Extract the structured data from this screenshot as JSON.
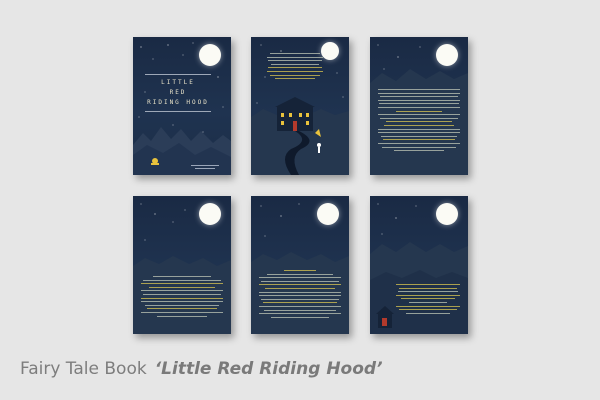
{
  "caption": {
    "prefix": "Fairy Tale Book",
    "title": "‘Little Red Riding Hood’"
  },
  "cover": {
    "line1": "LITTLE",
    "line2": "RED",
    "line3": "RIDING HOOD"
  },
  "colors": {
    "background": "#e6e6e6",
    "page": "#1b2d47",
    "moon": "#fbfbf5",
    "text_yellow": "#d9c650",
    "mountains": "#283a55"
  },
  "pages": [
    {
      "name": "cover",
      "icon": "moon-icon"
    },
    {
      "name": "house-scene",
      "icon": "house-icon"
    },
    {
      "name": "text-page-1",
      "icon": "moon-icon"
    },
    {
      "name": "text-page-2",
      "icon": "moon-icon"
    },
    {
      "name": "text-page-3",
      "icon": "moon-icon"
    },
    {
      "name": "final-page",
      "icon": "red-hood-figure-icon"
    }
  ]
}
